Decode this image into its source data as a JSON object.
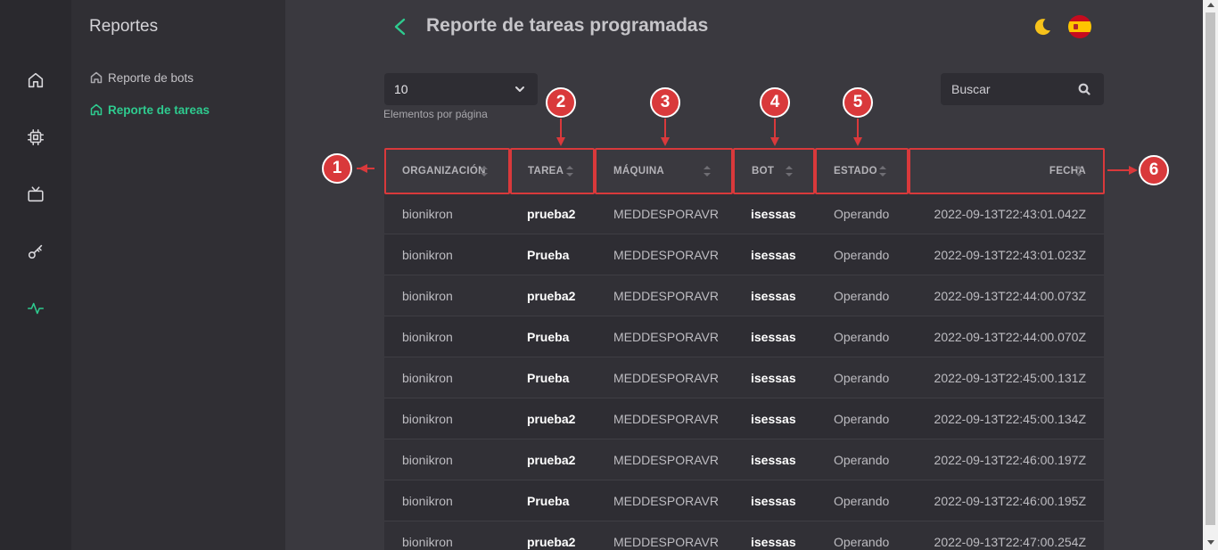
{
  "rail": {
    "items": [
      {
        "icon": "home-icon"
      },
      {
        "icon": "cpu-chip-icon"
      },
      {
        "icon": "tv-icon"
      },
      {
        "icon": "key-icon"
      },
      {
        "icon": "activity-icon",
        "active": true
      }
    ]
  },
  "sidebar": {
    "title": "Reportes",
    "items": [
      {
        "label": "Reporte de bots",
        "icon": "home-icon"
      },
      {
        "label": "Reporte de tareas",
        "icon": "home-icon",
        "active": true
      }
    ]
  },
  "header": {
    "title": "Reporte de tareas programadas",
    "back_icon": "chevron-left-icon",
    "theme_icon": "moon-icon",
    "language_icon": "spain-flag-icon"
  },
  "controls": {
    "page_size_value": "10",
    "page_size_label": "Elementos por página",
    "search_placeholder": "Buscar"
  },
  "table": {
    "columns": [
      "ORGANIZACIÓN",
      "TAREA",
      "MÁQUINA",
      "BOT",
      "ESTADO",
      "FECHA"
    ],
    "rows": [
      [
        "bionikron",
        "prueba2",
        "MEDDESPORAVR",
        "isessas",
        "Operando",
        "2022-09-13T22:43:01.042Z"
      ],
      [
        "bionikron",
        "Prueba",
        "MEDDESPORAVR",
        "isessas",
        "Operando",
        "2022-09-13T22:43:01.023Z"
      ],
      [
        "bionikron",
        "prueba2",
        "MEDDESPORAVR",
        "isessas",
        "Operando",
        "2022-09-13T22:44:00.073Z"
      ],
      [
        "bionikron",
        "Prueba",
        "MEDDESPORAVR",
        "isessas",
        "Operando",
        "2022-09-13T22:44:00.070Z"
      ],
      [
        "bionikron",
        "Prueba",
        "MEDDESPORAVR",
        "isessas",
        "Operando",
        "2022-09-13T22:45:00.131Z"
      ],
      [
        "bionikron",
        "prueba2",
        "MEDDESPORAVR",
        "isessas",
        "Operando",
        "2022-09-13T22:45:00.134Z"
      ],
      [
        "bionikron",
        "prueba2",
        "MEDDESPORAVR",
        "isessas",
        "Operando",
        "2022-09-13T22:46:00.197Z"
      ],
      [
        "bionikron",
        "Prueba",
        "MEDDESPORAVR",
        "isessas",
        "Operando",
        "2022-09-13T22:46:00.195Z"
      ],
      [
        "bionikron",
        "prueba2",
        "MEDDESPORAVR",
        "isessas",
        "Operando",
        "2022-09-13T22:47:00.254Z"
      ]
    ]
  },
  "annotations": [
    "1",
    "2",
    "3",
    "4",
    "5",
    "6"
  ],
  "colors": {
    "accent": "#2ecb8f",
    "annotation": "#d9393b",
    "rail_bg": "#2a292e",
    "sidebar_bg": "#302f34",
    "main_bg": "#3a393f"
  }
}
